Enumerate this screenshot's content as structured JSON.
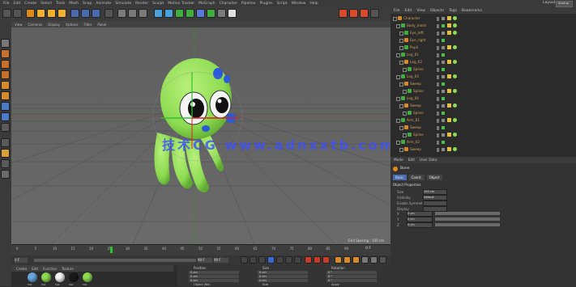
{
  "menu": {
    "items": [
      "File",
      "Edit",
      "Create",
      "Select",
      "Tools",
      "Mesh",
      "Snap",
      "Animate",
      "Simulate",
      "Render",
      "Sculpt",
      "Motion Tracker",
      "MoGraph",
      "Character",
      "Pipeline",
      "Plugins",
      "Script",
      "Window",
      "Help"
    ],
    "layout_label": "Layout:",
    "layout_value": "Startup"
  },
  "viewport": {
    "menu": [
      "View",
      "Cameras",
      "Display",
      "Options",
      "Filter",
      "Panel"
    ],
    "status": "Grid Spacing : 100 cm"
  },
  "watermark": "技术CG www.adnxxtb.com",
  "object_manager": {
    "tabs": [
      "File",
      "Edit",
      "View",
      "Objects",
      "Tags",
      "Bookmarks"
    ],
    "rows": [
      {
        "name": "Character",
        "indent": 0
      },
      {
        "name": "Body_mesh",
        "indent": 1
      },
      {
        "name": "Eye_left",
        "indent": 2
      },
      {
        "name": "Eye_right",
        "indent": 2
      },
      {
        "name": "Pupil",
        "indent": 2
      },
      {
        "name": "Leg_01",
        "indent": 1
      },
      {
        "name": "Leg_02",
        "indent": 2
      },
      {
        "name": "Spline",
        "indent": 3
      },
      {
        "name": "Leg_03",
        "indent": 1
      },
      {
        "name": "Sweep",
        "indent": 2
      },
      {
        "name": "Spline",
        "indent": 3
      },
      {
        "name": "Leg_04",
        "indent": 1
      },
      {
        "name": "Sweep",
        "indent": 2
      },
      {
        "name": "Spline",
        "indent": 3
      },
      {
        "name": "Arm_01",
        "indent": 1
      },
      {
        "name": "Sweep",
        "indent": 2
      },
      {
        "name": "Spline",
        "indent": 3
      },
      {
        "name": "Arm_02",
        "indent": 1
      },
      {
        "name": "Sweep",
        "indent": 2
      }
    ]
  },
  "attribute_manager": {
    "tabs": [
      "Mode",
      "Edit",
      "User Data"
    ],
    "object_title": "Bone",
    "subtabs": [
      "Basic",
      "Coord.",
      "Object"
    ],
    "section": "Object Properties",
    "fields": [
      {
        "label": "Size",
        "value": "100 cm"
      },
      {
        "label": "Visibility",
        "value": "Default"
      },
      {
        "label": "Enable Symmetry",
        "value": ""
      },
      {
        "label": "Display",
        "value": ""
      }
    ],
    "coords": [
      {
        "label": "X",
        "value": "0 cm"
      },
      {
        "label": "Y",
        "value": "0 cm"
      },
      {
        "label": "Z",
        "value": "0 cm"
      }
    ]
  },
  "timeline": {
    "ticks": [
      "0",
      "5",
      "10",
      "15",
      "20",
      "25",
      "30",
      "35",
      "40",
      "45",
      "50",
      "55",
      "60",
      "65",
      "70",
      "75",
      "80",
      "85",
      "90"
    ],
    "current_frame": "0 F",
    "start_frame": "0 F",
    "end_frame": "90 F",
    "end_frame_2": "90 F"
  },
  "materials": {
    "menu": [
      "Create",
      "Edit",
      "Function",
      "Texture"
    ],
    "labels": [
      "Mat",
      "Mat",
      "Mat",
      "Mat",
      "Mat"
    ]
  },
  "coordinates": {
    "headers": [
      "Position",
      "Size",
      "Rotation"
    ],
    "x": [
      "0 cm",
      "0 cm",
      "0 °"
    ],
    "y": [
      "0 cm",
      "0 cm",
      "0 °"
    ],
    "z": [
      "0 cm",
      "0 cm",
      "0 °"
    ],
    "mode_left": "Object (Rel)",
    "mode_mid": "Size",
    "apply": "Apply"
  },
  "colors": {
    "accent": "#e08a1a",
    "grid_axis": "#ff3b3b",
    "character_green": "#8ddb52",
    "eye_blue": "#2a5ad8"
  }
}
